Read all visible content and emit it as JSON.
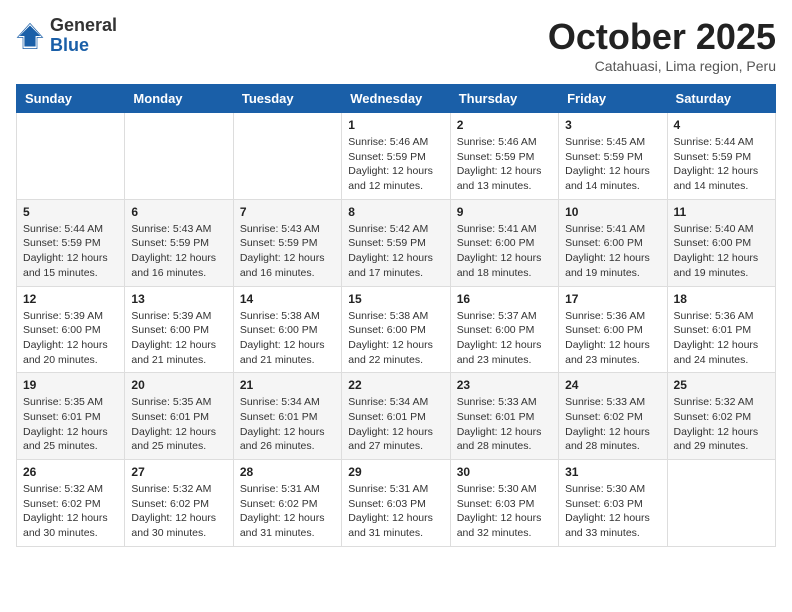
{
  "logo": {
    "general": "General",
    "blue": "Blue"
  },
  "header": {
    "month": "October 2025",
    "location": "Catahuasi, Lima region, Peru"
  },
  "days_of_week": [
    "Sunday",
    "Monday",
    "Tuesday",
    "Wednesday",
    "Thursday",
    "Friday",
    "Saturday"
  ],
  "weeks": [
    [
      null,
      null,
      null,
      {
        "day": "1",
        "sunrise": "Sunrise: 5:46 AM",
        "sunset": "Sunset: 5:59 PM",
        "daylight": "Daylight: 12 hours and 12 minutes."
      },
      {
        "day": "2",
        "sunrise": "Sunrise: 5:46 AM",
        "sunset": "Sunset: 5:59 PM",
        "daylight": "Daylight: 12 hours and 13 minutes."
      },
      {
        "day": "3",
        "sunrise": "Sunrise: 5:45 AM",
        "sunset": "Sunset: 5:59 PM",
        "daylight": "Daylight: 12 hours and 14 minutes."
      },
      {
        "day": "4",
        "sunrise": "Sunrise: 5:44 AM",
        "sunset": "Sunset: 5:59 PM",
        "daylight": "Daylight: 12 hours and 14 minutes."
      }
    ],
    [
      {
        "day": "5",
        "sunrise": "Sunrise: 5:44 AM",
        "sunset": "Sunset: 5:59 PM",
        "daylight": "Daylight: 12 hours and 15 minutes."
      },
      {
        "day": "6",
        "sunrise": "Sunrise: 5:43 AM",
        "sunset": "Sunset: 5:59 PM",
        "daylight": "Daylight: 12 hours and 16 minutes."
      },
      {
        "day": "7",
        "sunrise": "Sunrise: 5:43 AM",
        "sunset": "Sunset: 5:59 PM",
        "daylight": "Daylight: 12 hours and 16 minutes."
      },
      {
        "day": "8",
        "sunrise": "Sunrise: 5:42 AM",
        "sunset": "Sunset: 5:59 PM",
        "daylight": "Daylight: 12 hours and 17 minutes."
      },
      {
        "day": "9",
        "sunrise": "Sunrise: 5:41 AM",
        "sunset": "Sunset: 6:00 PM",
        "daylight": "Daylight: 12 hours and 18 minutes."
      },
      {
        "day": "10",
        "sunrise": "Sunrise: 5:41 AM",
        "sunset": "Sunset: 6:00 PM",
        "daylight": "Daylight: 12 hours and 19 minutes."
      },
      {
        "day": "11",
        "sunrise": "Sunrise: 5:40 AM",
        "sunset": "Sunset: 6:00 PM",
        "daylight": "Daylight: 12 hours and 19 minutes."
      }
    ],
    [
      {
        "day": "12",
        "sunrise": "Sunrise: 5:39 AM",
        "sunset": "Sunset: 6:00 PM",
        "daylight": "Daylight: 12 hours and 20 minutes."
      },
      {
        "day": "13",
        "sunrise": "Sunrise: 5:39 AM",
        "sunset": "Sunset: 6:00 PM",
        "daylight": "Daylight: 12 hours and 21 minutes."
      },
      {
        "day": "14",
        "sunrise": "Sunrise: 5:38 AM",
        "sunset": "Sunset: 6:00 PM",
        "daylight": "Daylight: 12 hours and 21 minutes."
      },
      {
        "day": "15",
        "sunrise": "Sunrise: 5:38 AM",
        "sunset": "Sunset: 6:00 PM",
        "daylight": "Daylight: 12 hours and 22 minutes."
      },
      {
        "day": "16",
        "sunrise": "Sunrise: 5:37 AM",
        "sunset": "Sunset: 6:00 PM",
        "daylight": "Daylight: 12 hours and 23 minutes."
      },
      {
        "day": "17",
        "sunrise": "Sunrise: 5:36 AM",
        "sunset": "Sunset: 6:00 PM",
        "daylight": "Daylight: 12 hours and 23 minutes."
      },
      {
        "day": "18",
        "sunrise": "Sunrise: 5:36 AM",
        "sunset": "Sunset: 6:01 PM",
        "daylight": "Daylight: 12 hours and 24 minutes."
      }
    ],
    [
      {
        "day": "19",
        "sunrise": "Sunrise: 5:35 AM",
        "sunset": "Sunset: 6:01 PM",
        "daylight": "Daylight: 12 hours and 25 minutes."
      },
      {
        "day": "20",
        "sunrise": "Sunrise: 5:35 AM",
        "sunset": "Sunset: 6:01 PM",
        "daylight": "Daylight: 12 hours and 25 minutes."
      },
      {
        "day": "21",
        "sunrise": "Sunrise: 5:34 AM",
        "sunset": "Sunset: 6:01 PM",
        "daylight": "Daylight: 12 hours and 26 minutes."
      },
      {
        "day": "22",
        "sunrise": "Sunrise: 5:34 AM",
        "sunset": "Sunset: 6:01 PM",
        "daylight": "Daylight: 12 hours and 27 minutes."
      },
      {
        "day": "23",
        "sunrise": "Sunrise: 5:33 AM",
        "sunset": "Sunset: 6:01 PM",
        "daylight": "Daylight: 12 hours and 28 minutes."
      },
      {
        "day": "24",
        "sunrise": "Sunrise: 5:33 AM",
        "sunset": "Sunset: 6:02 PM",
        "daylight": "Daylight: 12 hours and 28 minutes."
      },
      {
        "day": "25",
        "sunrise": "Sunrise: 5:32 AM",
        "sunset": "Sunset: 6:02 PM",
        "daylight": "Daylight: 12 hours and 29 minutes."
      }
    ],
    [
      {
        "day": "26",
        "sunrise": "Sunrise: 5:32 AM",
        "sunset": "Sunset: 6:02 PM",
        "daylight": "Daylight: 12 hours and 30 minutes."
      },
      {
        "day": "27",
        "sunrise": "Sunrise: 5:32 AM",
        "sunset": "Sunset: 6:02 PM",
        "daylight": "Daylight: 12 hours and 30 minutes."
      },
      {
        "day": "28",
        "sunrise": "Sunrise: 5:31 AM",
        "sunset": "Sunset: 6:02 PM",
        "daylight": "Daylight: 12 hours and 31 minutes."
      },
      {
        "day": "29",
        "sunrise": "Sunrise: 5:31 AM",
        "sunset": "Sunset: 6:03 PM",
        "daylight": "Daylight: 12 hours and 31 minutes."
      },
      {
        "day": "30",
        "sunrise": "Sunrise: 5:30 AM",
        "sunset": "Sunset: 6:03 PM",
        "daylight": "Daylight: 12 hours and 32 minutes."
      },
      {
        "day": "31",
        "sunrise": "Sunrise: 5:30 AM",
        "sunset": "Sunset: 6:03 PM",
        "daylight": "Daylight: 12 hours and 33 minutes."
      },
      null
    ]
  ]
}
